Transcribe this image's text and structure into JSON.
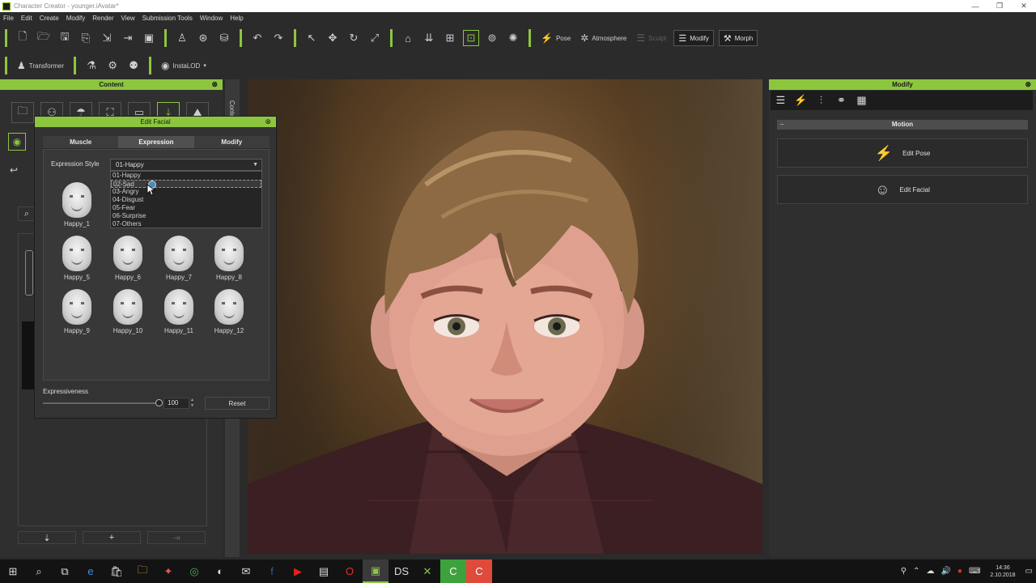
{
  "window": {
    "title": "Character Creator - younger.iAvatar*",
    "min": "—",
    "max": "❐",
    "close": "✕"
  },
  "menu": [
    "File",
    "Edit",
    "Create",
    "Modify",
    "Render",
    "View",
    "Submission Tools",
    "Window",
    "Help"
  ],
  "toolbar": {
    "pose_label": "Pose",
    "atmosphere_label": "Atmosphere",
    "sculpt_label": "Sculpt",
    "modify_label": "Modify",
    "morph_label": "Morph",
    "transformer_label": "Transformer",
    "instalod_label": "InstaLOD"
  },
  "content_panel": {
    "title": "Content",
    "side_tab": "Content"
  },
  "edit_facial": {
    "title": "Edit Facial",
    "tabs": [
      "Muscle",
      "Expression",
      "Modify"
    ],
    "active_tab": "Expression",
    "style_label": "Expression Style",
    "style_value": "01-Happy",
    "style_options": [
      "01-Happy",
      "02-Sad",
      "03-Angry",
      "04-Disgust",
      "05-Fear",
      "06-Surprise",
      "07-Others"
    ],
    "hovered_option": "02-Sad",
    "faces": [
      "Happy_1",
      "Happy_5",
      "Happy_6",
      "Happy_7",
      "Happy_8",
      "Happy_9",
      "Happy_10",
      "Happy_11",
      "Happy_12"
    ],
    "expressiveness_label": "Expressiveness",
    "expressiveness_value": "100",
    "reset_label": "Reset"
  },
  "modify_panel": {
    "title": "Modify",
    "section": "Motion",
    "edit_pose_label": "Edit Pose",
    "edit_facial_label": "Edit Facial"
  },
  "taskbar": {
    "time": "14:36",
    "date": "2.10.2018"
  },
  "colors": {
    "accent": "#8cc63f",
    "panel_bg": "#2f2f2f",
    "header_text": "#1a1a1a"
  }
}
